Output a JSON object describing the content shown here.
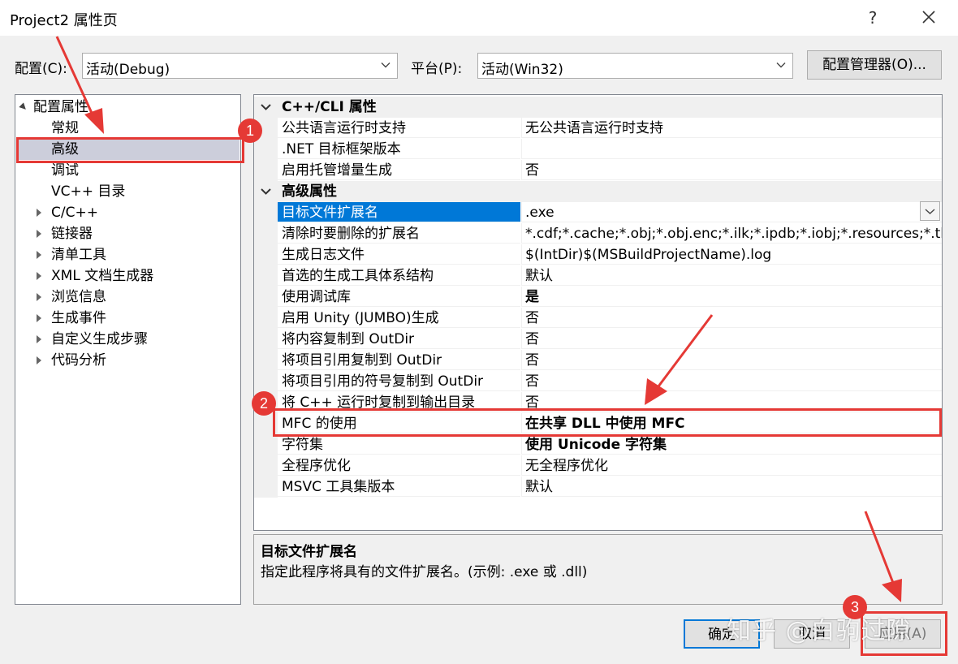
{
  "window": {
    "title": "Project2 属性页",
    "help": "?"
  },
  "toolbar": {
    "config_label": "配置(C):",
    "config_value": "活动(Debug)",
    "platform_label": "平台(P):",
    "platform_value": "活动(Win32)",
    "config_manager": "配置管理器(O)..."
  },
  "tree": {
    "root": "配置属性",
    "items": [
      "常规",
      "高级",
      "调试",
      "VC++ 目录"
    ],
    "expandable": [
      "C/C++",
      "链接器",
      "清单工具",
      "XML 文档生成器",
      "浏览信息",
      "生成事件",
      "自定义生成步骤",
      "代码分析"
    ]
  },
  "grid": {
    "cat1": "C++/CLI 属性",
    "cat1_rows": [
      {
        "name": "公共语言运行时支持",
        "value": "无公共语言运行时支持"
      },
      {
        "name": ".NET 目标框架版本",
        "value": ""
      },
      {
        "name": "启用托管增量生成",
        "value": "否"
      }
    ],
    "cat2": "高级属性",
    "cat2_rows": [
      {
        "name": "目标文件扩展名",
        "value": ".exe"
      },
      {
        "name": "清除时要删除的扩展名",
        "value": "*.cdf;*.cache;*.obj;*.obj.enc;*.ilk;*.ipdb;*.iobj;*.resources;*.tlb;*"
      },
      {
        "name": "生成日志文件",
        "value": "$(IntDir)$(MSBuildProjectName).log"
      },
      {
        "name": "首选的生成工具体系结构",
        "value": "默认"
      },
      {
        "name": "使用调试库",
        "value": "是"
      },
      {
        "name": "启用 Unity (JUMBO)生成",
        "value": "否"
      },
      {
        "name": "将内容复制到 OutDir",
        "value": "否"
      },
      {
        "name": "将项目引用复制到 OutDir",
        "value": "否"
      },
      {
        "name": "将项目引用的符号复制到 OutDir",
        "value": "否"
      },
      {
        "name": "将 C++ 运行时复制到输出目录",
        "value": "否"
      },
      {
        "name": "MFC 的使用",
        "value": "在共享 DLL 中使用 MFC"
      },
      {
        "name": "字符集",
        "value": "使用 Unicode 字符集"
      },
      {
        "name": "全程序优化",
        "value": "无全程序优化"
      },
      {
        "name": "MSVC 工具集版本",
        "value": "默认"
      }
    ]
  },
  "description": {
    "title": "目标文件扩展名",
    "text": "指定此程序将具有的文件扩展名。(示例: .exe 或 .dll)"
  },
  "buttons": {
    "ok": "确定",
    "cancel": "取消",
    "apply": "应用(A)"
  },
  "annotations": {
    "badge1": "1",
    "badge2": "2",
    "badge3": "3"
  },
  "watermark": "知乎 @白驹过隙",
  "colors": {
    "selection": "#0078d7",
    "tree_selection": "#cccedb",
    "annotation": "#e53935"
  }
}
